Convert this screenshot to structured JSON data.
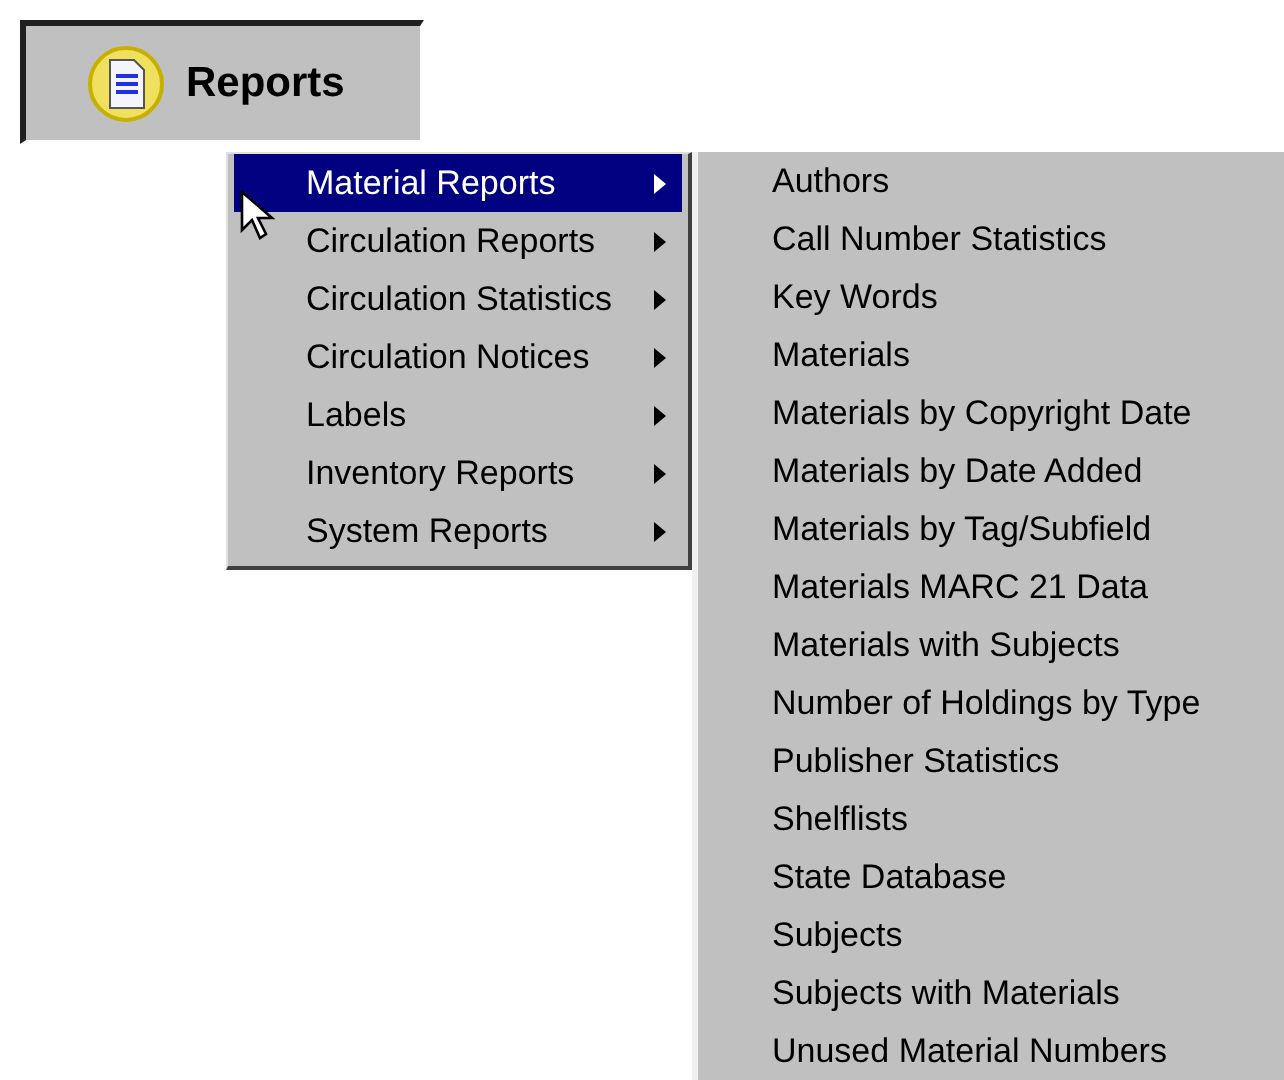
{
  "toolbar_button": {
    "label": "Reports",
    "pressed": true
  },
  "menu": {
    "items": [
      {
        "label": "Material Reports",
        "selected": true
      },
      {
        "label": "Circulation Reports",
        "selected": false
      },
      {
        "label": "Circulation Statistics",
        "selected": false
      },
      {
        "label": "Circulation Notices",
        "selected": false
      },
      {
        "label": "Labels",
        "selected": false
      },
      {
        "label": "Inventory Reports",
        "selected": false
      },
      {
        "label": "System Reports",
        "selected": false
      }
    ]
  },
  "submenu": {
    "items": [
      "Authors",
      "Call Number Statistics",
      "Key Words",
      "Materials",
      "Materials by Copyright Date",
      "Materials by Date Added",
      "Materials by Tag/Subfield",
      "Materials MARC 21 Data",
      "Materials with Subjects",
      "Number of Holdings by Type",
      "Publisher Statistics",
      "Shelflists",
      "State Database",
      "Subjects",
      "Subjects with Materials",
      "Unused Material Numbers"
    ]
  }
}
